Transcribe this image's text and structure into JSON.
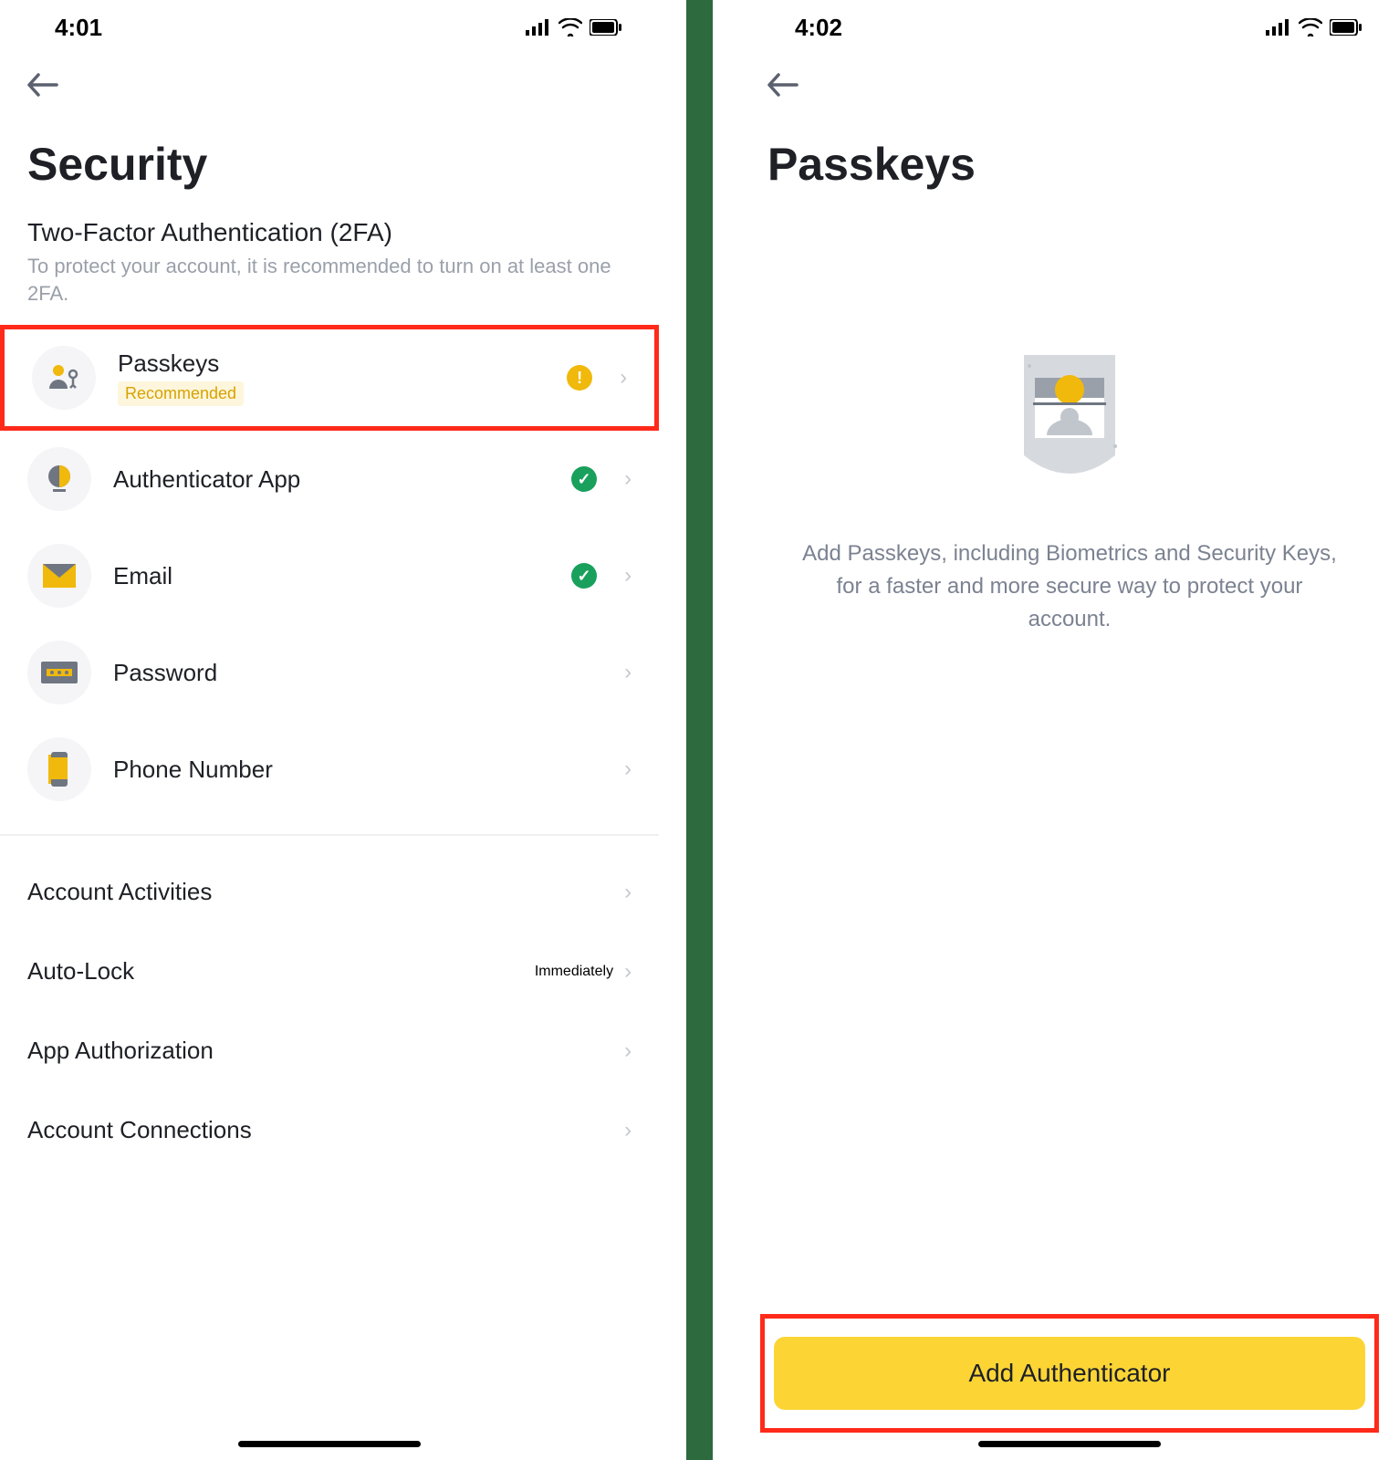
{
  "left": {
    "status_time": "4:01",
    "page_title": "Security",
    "section_title": "Two-Factor Authentication (2FA)",
    "section_sub": "To protect your account, it is recommended to turn on at least one 2FA.",
    "items": [
      {
        "label": "Passkeys",
        "badge": "Recommended",
        "status": "warn"
      },
      {
        "label": "Authenticator App",
        "status": "ok"
      },
      {
        "label": "Email",
        "status": "ok"
      },
      {
        "label": "Password"
      },
      {
        "label": "Phone Number"
      }
    ],
    "rows": [
      {
        "label": "Account Activities"
      },
      {
        "label": "Auto-Lock",
        "value": "Immediately"
      },
      {
        "label": "App Authorization"
      },
      {
        "label": "Account Connections"
      }
    ]
  },
  "right": {
    "status_time": "4:02",
    "page_title": "Passkeys",
    "description": "Add Passkeys, including Biometrics and Security Keys, for a faster and more secure way to protect your account.",
    "cta_label": "Add Authenticator"
  },
  "colors": {
    "accent": "#fcd535",
    "ok": "#19a05c",
    "warn": "#f0b90b",
    "highlight": "#ff2a1a"
  }
}
